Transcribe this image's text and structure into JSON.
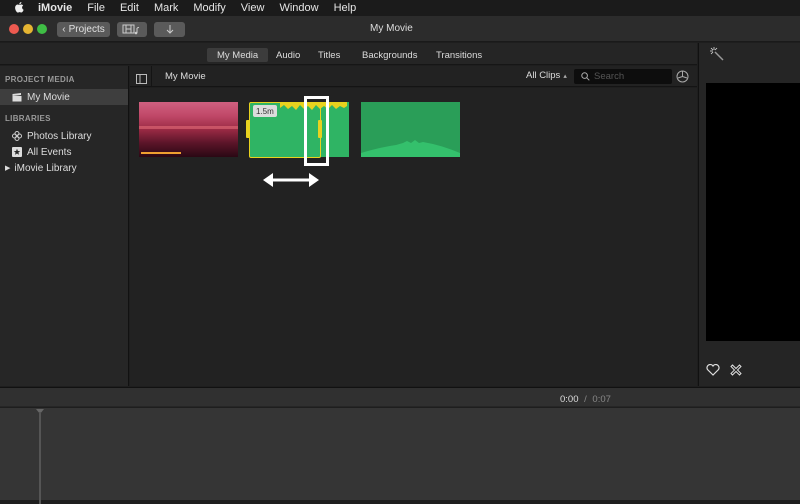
{
  "menubar": {
    "app_name": "iMovie",
    "items": [
      "File",
      "Edit",
      "Mark",
      "Modify",
      "View",
      "Window",
      "Help"
    ]
  },
  "titlebar": {
    "window_title": "My Movie",
    "projects_button": "Projects",
    "media_toggle_icon": "film-music-icon",
    "import_icon": "download-arrow-icon"
  },
  "browser_tabs": [
    {
      "label": "My Media",
      "active": true
    },
    {
      "label": "Audio",
      "active": false
    },
    {
      "label": "Titles",
      "active": false
    },
    {
      "label": "Backgrounds",
      "active": false
    },
    {
      "label": "Transitions",
      "active": false
    }
  ],
  "sidebar": {
    "project_media_header": "PROJECT MEDIA",
    "project_item": "My Movie",
    "libraries_header": "LIBRARIES",
    "libraries": [
      {
        "label": "Photos Library",
        "icon": "photos-icon"
      },
      {
        "label": "All Events",
        "icon": "star-icon"
      },
      {
        "label": "iMovie Library",
        "icon": "disclosure-triangle-icon"
      }
    ]
  },
  "content_bar": {
    "title": "My Movie",
    "filter": "All Clips",
    "search_placeholder": "Search"
  },
  "clips": [
    {
      "name": "sunset-video-clip",
      "type": "video",
      "colors": {
        "top": "#c0506a",
        "mid": "#b03048",
        "bottom": "#2a0a1a"
      },
      "progress": 0.42
    },
    {
      "name": "green-audio-clip-selected",
      "type": "audio",
      "duration_badge": "1.5m",
      "selected": true
    },
    {
      "name": "green-audio-clip",
      "type": "audio"
    }
  ],
  "annotation": {
    "arrow_icon": "double-arrow-icon"
  },
  "viewer": {
    "magic_wand_icon": "magic-wand-icon",
    "favorite_icon": "heart-icon",
    "reject_icon": "reject-x-icon"
  },
  "timeline": {
    "current": "0:00",
    "separator": "/",
    "duration": "0:07"
  },
  "colors": {
    "clip_green": "#2fb464",
    "selection_yellow": "#e8d21f",
    "progress_orange": "#f0a030"
  }
}
